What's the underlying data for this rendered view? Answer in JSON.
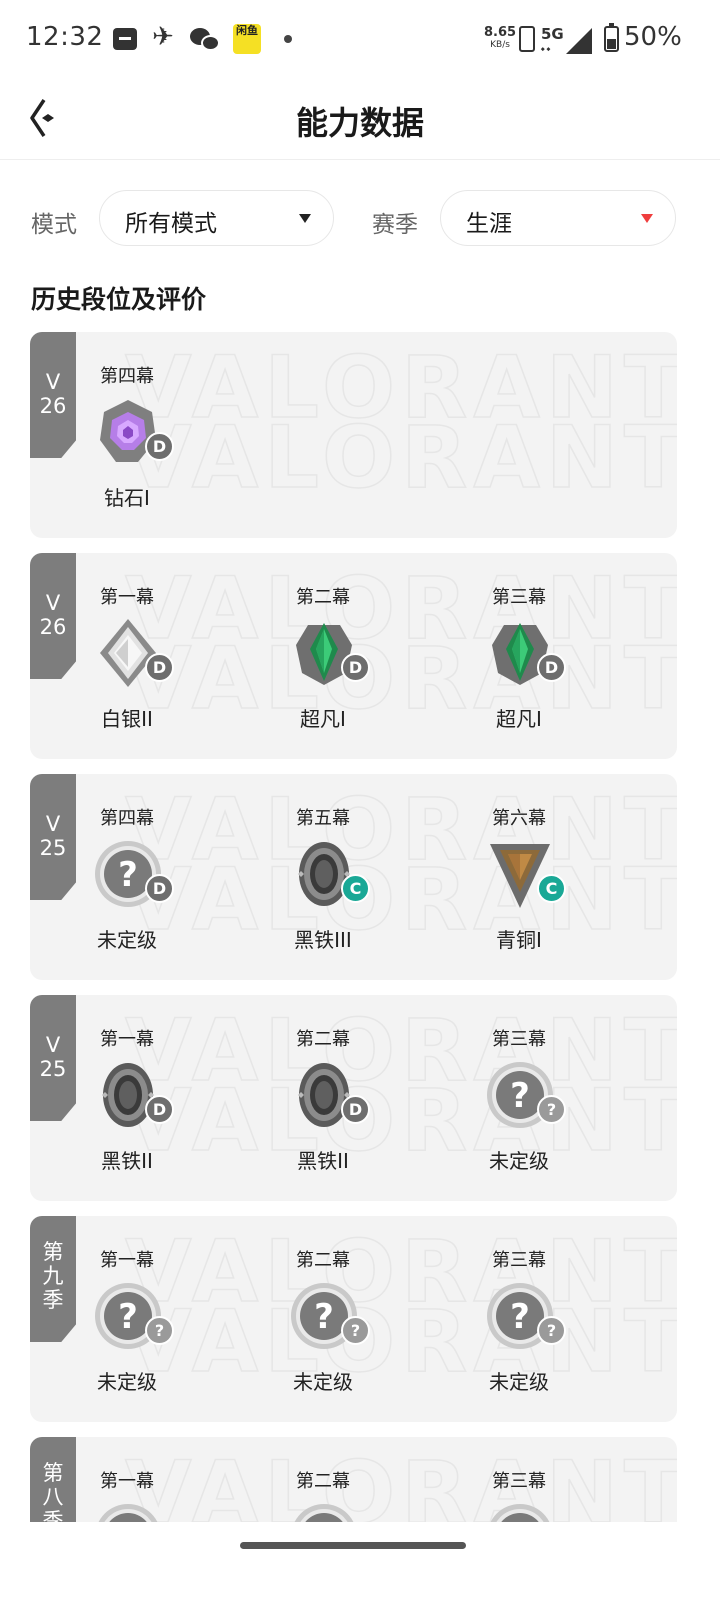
{
  "status_bar": {
    "time": "12:32",
    "app_badge": "闲鱼",
    "net_speed": "8.65",
    "net_unit": "KB/s",
    "network": "5G",
    "battery": "50%",
    "icons": [
      "message-icon",
      "send-icon",
      "wechat-icon",
      "app-icon",
      "dot-icon",
      "hd-icon",
      "signal-icon",
      "battery-icon"
    ]
  },
  "header": {
    "title": "能力数据",
    "back_icon": "back-arrow-icon"
  },
  "filters": {
    "mode_label": "模式",
    "mode_value": "所有模式",
    "season_label": "赛季",
    "season_value": "生涯"
  },
  "section_title": "历史段位及评价",
  "watermark": "VALORANT",
  "seasons": [
    {
      "tag": "V\n26",
      "acts": [
        {
          "act": "第四幕",
          "rank": "钻石I",
          "grade": "D",
          "icon": "diamond-rank-icon"
        }
      ]
    },
    {
      "tag": "V\n26",
      "acts": [
        {
          "act": "第一幕",
          "rank": "白银II",
          "grade": "D",
          "icon": "silver-rank-icon"
        },
        {
          "act": "第二幕",
          "rank": "超凡I",
          "grade": "D",
          "icon": "ascendant-rank-icon"
        },
        {
          "act": "第三幕",
          "rank": "超凡I",
          "grade": "D",
          "icon": "ascendant-rank-icon"
        }
      ]
    },
    {
      "tag": "V\n25",
      "acts": [
        {
          "act": "第四幕",
          "rank": "未定级",
          "grade": "D",
          "icon": "unranked-icon"
        },
        {
          "act": "第五幕",
          "rank": "黑铁III",
          "grade": "C",
          "icon": "iron-rank-icon"
        },
        {
          "act": "第六幕",
          "rank": "青铜I",
          "grade": "C",
          "icon": "bronze-rank-icon"
        }
      ]
    },
    {
      "tag": "V\n25",
      "acts": [
        {
          "act": "第一幕",
          "rank": "黑铁II",
          "grade": "D",
          "icon": "iron-rank-icon"
        },
        {
          "act": "第二幕",
          "rank": "黑铁II",
          "grade": "D",
          "icon": "iron-rank-icon"
        },
        {
          "act": "第三幕",
          "rank": "未定级",
          "grade": "?",
          "icon": "unranked-icon"
        }
      ]
    },
    {
      "tag": "第\n九\n季",
      "acts": [
        {
          "act": "第一幕",
          "rank": "未定级",
          "grade": "?",
          "icon": "unranked-icon"
        },
        {
          "act": "第二幕",
          "rank": "未定级",
          "grade": "?",
          "icon": "unranked-icon"
        },
        {
          "act": "第三幕",
          "rank": "未定级",
          "grade": "?",
          "icon": "unranked-icon"
        }
      ]
    },
    {
      "tag": "第\n八\n季",
      "acts": [
        {
          "act": "第一幕",
          "rank": "",
          "grade": "",
          "icon": "unranked-icon"
        },
        {
          "act": "第二幕",
          "rank": "",
          "grade": "",
          "icon": "unranked-icon"
        },
        {
          "act": "第三幕",
          "rank": "",
          "grade": "",
          "icon": "unranked-icon"
        }
      ]
    }
  ],
  "colors": {
    "tag_bg": "#7d7d7d",
    "card_bg": "#f3f3f3",
    "grade_d": "#6e6e6e",
    "grade_c": "#1aa896",
    "caret_red": "#ef3d3d"
  }
}
